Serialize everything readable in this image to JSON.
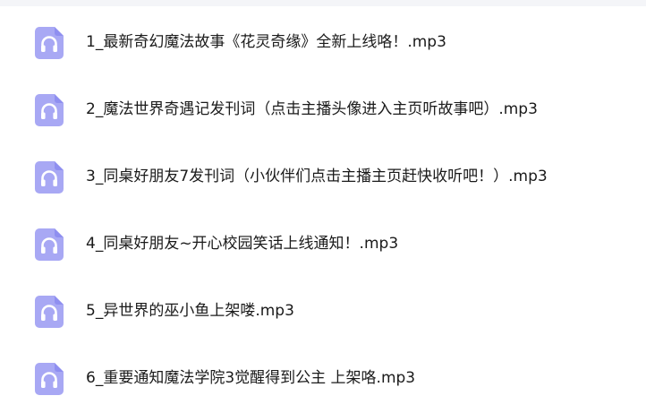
{
  "files": [
    {
      "name": "1_最新奇幻魔法故事《花灵奇缘》全新上线咯！.mp3",
      "icon": "audio-file-icon"
    },
    {
      "name": "2_魔法世界奇遇记发刊词（点击主播头像进入主页听故事吧）.mp3",
      "icon": "audio-file-icon"
    },
    {
      "name": "3_同桌好朋友7发刊词（小伙伴们点击主播主页赶快收听吧！）.mp3",
      "icon": "audio-file-icon"
    },
    {
      "name": "4_同桌好朋友~开心校园笑话上线通知！.mp3",
      "icon": "audio-file-icon"
    },
    {
      "name": "5_异世界的巫小鱼上架喽.mp3",
      "icon": "audio-file-icon"
    },
    {
      "name": "6_重要通知魔法学院3觉醒得到公主 上架咯.mp3",
      "icon": "audio-file-icon"
    }
  ],
  "colors": {
    "icon_fill": "#a8a8f4",
    "icon_fold": "#8f8ff0",
    "headphone": "#ffffff",
    "text": "#1a1a1a"
  }
}
